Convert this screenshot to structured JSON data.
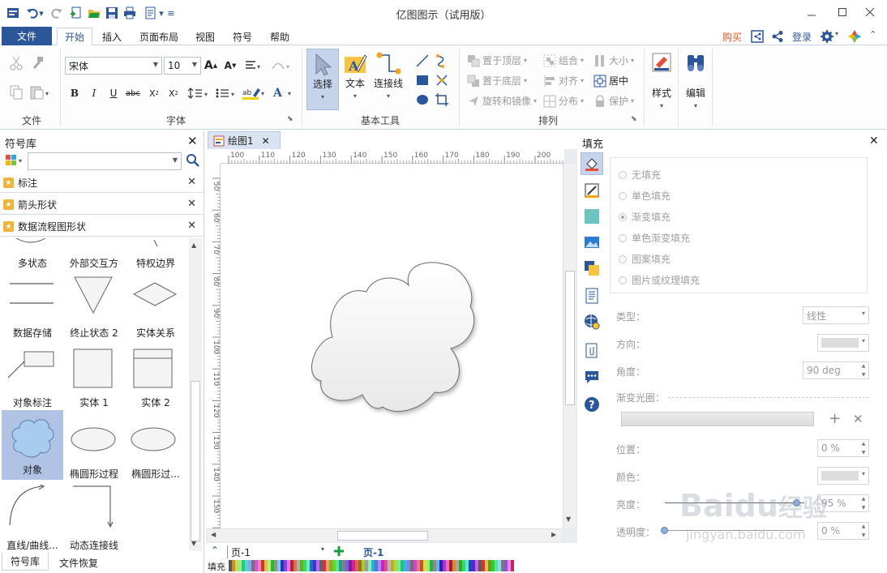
{
  "window": {
    "title": "亿图图示（试用版）"
  },
  "menu": {
    "file": "文件",
    "tabs": [
      "开始",
      "插入",
      "页面布局",
      "视图",
      "符号",
      "帮助"
    ],
    "buy": "购买",
    "login": "登录"
  },
  "ribbon": {
    "groups": {
      "file": "文件",
      "font": "字体",
      "basic_tools": "基本工具",
      "arrange": "排列"
    },
    "font_name": "宋体",
    "font_size": "10",
    "basic_tools": {
      "select": "选择",
      "text": "文本",
      "connector": "连接线"
    },
    "arrange": {
      "bring_front": "置于顶层",
      "send_back": "置于底层",
      "rotate_mirror": "旋转和镜像",
      "group": "组合",
      "align": "对齐",
      "distribute": "分布",
      "size": "大小",
      "center": "居中",
      "protect": "保护"
    },
    "style": "样式",
    "edit": "编辑"
  },
  "library": {
    "title": "符号库",
    "categories": [
      "标注",
      "箭头形状",
      "数据流程图形状"
    ],
    "shapes": [
      "多状态",
      "外部交互方",
      "特权边界",
      "数据存储",
      "终止状态 2",
      "实体关系",
      "对象标注",
      "实体 1",
      "实体 2",
      "对象",
      "椭圆形过程",
      "椭圆形过...",
      "直线/曲线...",
      "动态连接线"
    ],
    "bottom_tabs": [
      "符号库",
      "文件恢复"
    ]
  },
  "document": {
    "tab": "绘图1",
    "hruler": [
      "100",
      "110",
      "120",
      "130",
      "140",
      "150",
      "160",
      "170",
      "180",
      "190",
      "200"
    ],
    "vruler": [
      "50",
      "60",
      "70",
      "80",
      "90",
      "100",
      "110",
      "120",
      "130",
      "140",
      "150",
      "160"
    ],
    "page_selector": "页-1",
    "page_tab": "页-1",
    "fill_label": "填充"
  },
  "fill_panel": {
    "title": "填充",
    "options": [
      "无填充",
      "单色填充",
      "渐变填充",
      "单色渐变填充",
      "图案填充",
      "图片或纹理填充"
    ],
    "selected_option": "渐变填充",
    "type_label": "类型：",
    "type_value": "线性",
    "direction_label": "方向：",
    "angle_label": "角度：",
    "angle_value": "90 deg",
    "gradient_label": "渐变光圈：",
    "position_label": "位置：",
    "position_value": "0 %",
    "color_label": "颜色：",
    "brightness_label": "亮度：",
    "brightness_value": "95 %",
    "transparency_label": "透明度：",
    "transparency_value": "0 %"
  },
  "watermark": {
    "brand": "Baidu",
    "brand_cn": "经验",
    "url": "jingyan.baidu.com"
  },
  "colors": {
    "accent": "#2b579a",
    "buy": "#e8541e",
    "selected_shape": "#b0c3e5",
    "cloud_fill": "#f2f2f2"
  }
}
